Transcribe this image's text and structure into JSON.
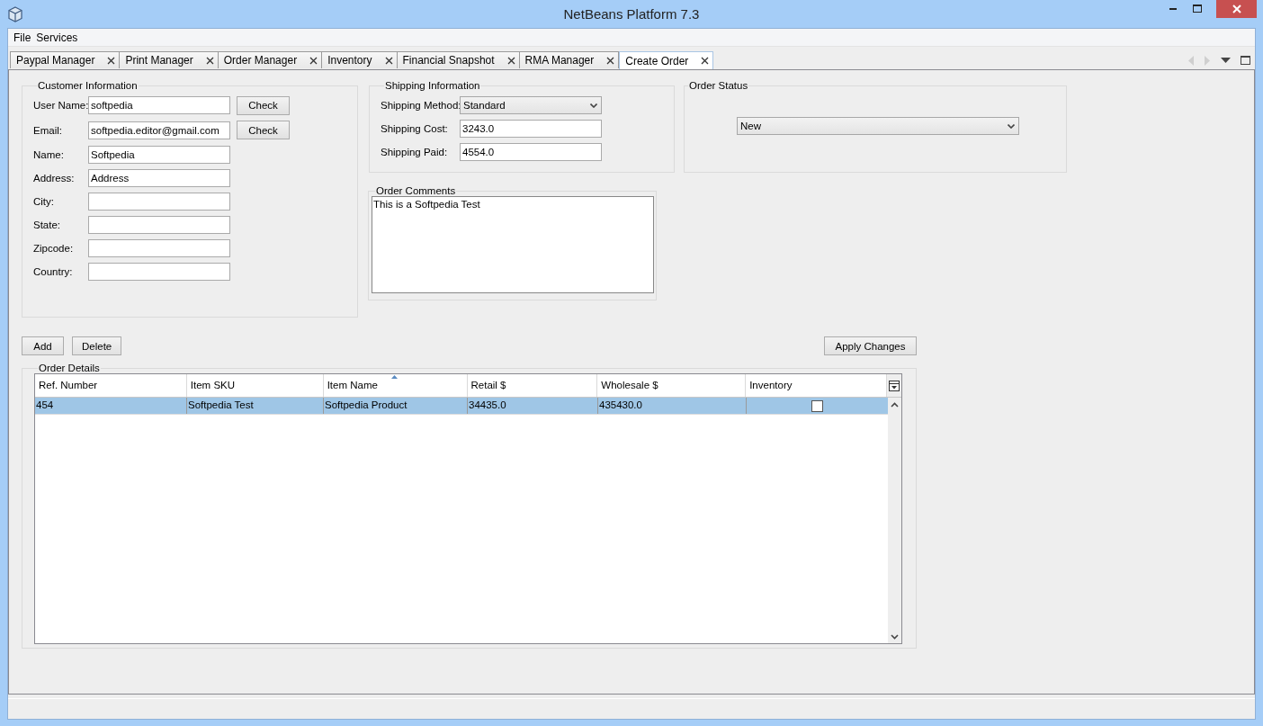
{
  "window": {
    "title": "NetBeans Platform 7.3"
  },
  "menu": [
    "File",
    "Services"
  ],
  "tabs": [
    {
      "label": "Paypal Manager",
      "selected": false
    },
    {
      "label": "Print Manager",
      "selected": false
    },
    {
      "label": "Order Manager",
      "selected": false
    },
    {
      "label": "Inventory",
      "selected": false
    },
    {
      "label": "Financial Snapshot",
      "selected": false
    },
    {
      "label": "RMA Manager",
      "selected": false
    },
    {
      "label": "Create Order",
      "selected": true
    }
  ],
  "customer_information": {
    "title": "Customer Information",
    "fields": [
      {
        "label": "User Name:",
        "value": "softpedia",
        "button": "Check"
      },
      {
        "label": "Email:",
        "value": "softpedia.editor@gmail.com",
        "button": "Check"
      },
      {
        "label": "Name:",
        "value": "Softpedia"
      },
      {
        "label": "Address:",
        "value": "Address"
      },
      {
        "label": "City:"
      },
      {
        "label": "State:"
      },
      {
        "label": "Zipcode:"
      },
      {
        "label": "Country:"
      }
    ]
  },
  "shipping_information": {
    "title": "Shipping Information",
    "fields": [
      {
        "kind": "dropdown",
        "label": "Shipping Method:",
        "value": "Standard"
      },
      {
        "kind": "text",
        "label": "Shipping Cost:",
        "value": "3243.0"
      },
      {
        "kind": "text",
        "label": "Shipping Paid:",
        "value": "4554.0"
      }
    ]
  },
  "order_status": {
    "title": "Order Status",
    "value": "New"
  },
  "order_comments": {
    "title": "Order Comments",
    "text": "This is a Softpedia Test"
  },
  "buttons": [
    "Add",
    "Delete"
  ],
  "apply_button": "Apply Changes",
  "order_details": {
    "title": "Order Details",
    "columns": [
      {
        "label": "Ref. Number",
        "sorted": false
      },
      {
        "label": "Item SKU",
        "sorted": false
      },
      {
        "label": "Item Name",
        "sorted": true
      },
      {
        "label": "Retail $",
        "sorted": false
      },
      {
        "label": "Wholesale $",
        "sorted": false
      },
      {
        "label": "Inventory",
        "sorted": false
      }
    ],
    "rows": [
      {
        "selected": true,
        "cells": [
          "454",
          "Softpedia Test",
          "Softpedia Product",
          "34435.0",
          "435430.0"
        ],
        "inventory": false
      }
    ]
  }
}
